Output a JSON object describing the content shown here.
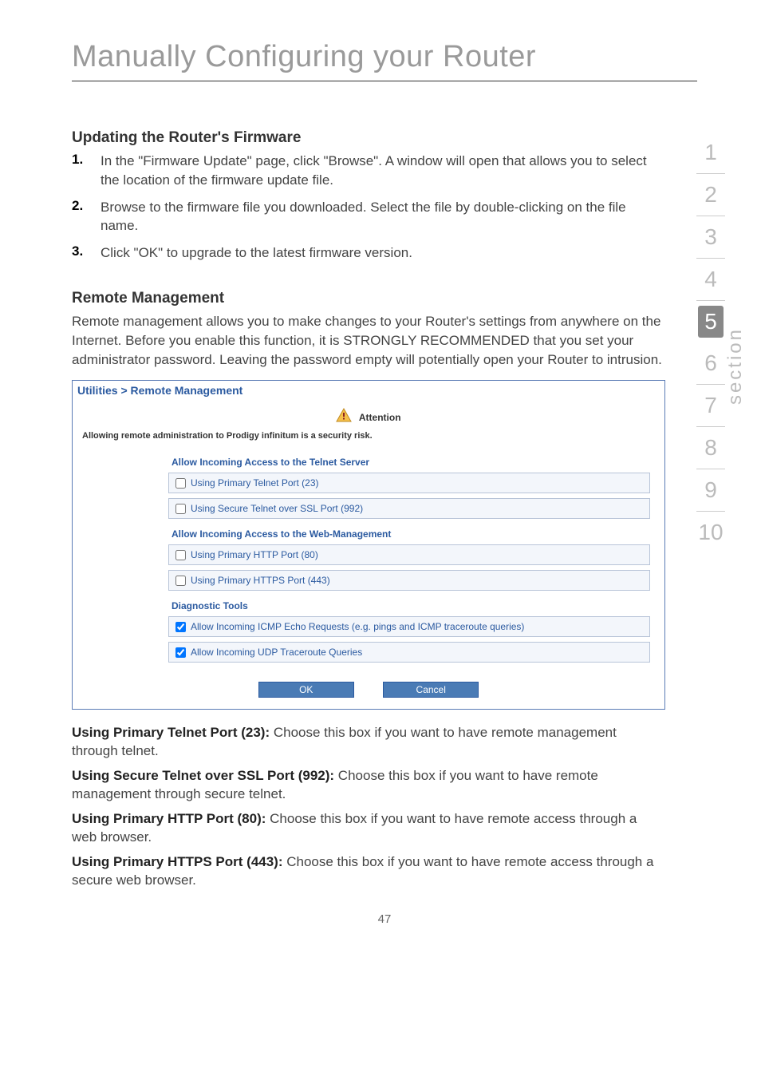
{
  "page_title": "Manually Configuring your Router",
  "nav": {
    "items": [
      "1",
      "2",
      "3",
      "4",
      "5",
      "6",
      "7",
      "8",
      "9",
      "10"
    ],
    "active_index": 4,
    "label": "section"
  },
  "updating": {
    "heading": "Updating the Router's Firmware",
    "steps": [
      {
        "num": "1.",
        "text": "In the \"Firmware Update\" page, click \"Browse\". A window will open that allows you to select the location of the firmware update file."
      },
      {
        "num": "2.",
        "text": "Browse to the firmware file you downloaded. Select the file by double-clicking on the file name."
      },
      {
        "num": "3.",
        "text": "Click \"OK\" to upgrade to the latest firmware version."
      }
    ]
  },
  "remote": {
    "heading": "Remote Management",
    "intro": "Remote management allows you to make changes to your Router's settings from anywhere on the Internet. Before you enable this function, it is STRONGLY RECOMMENDED that you set your administrator password. Leaving the password empty will potentially open your Router to intrusion."
  },
  "panel": {
    "header": "Utilities > Remote Management",
    "attention_label": "Attention",
    "attention_sub": "Allowing remote administration to Prodigy infinitum is a security risk.",
    "sections": [
      {
        "heading": "Allow Incoming Access to the Telnet Server",
        "rows": [
          {
            "label": "Using Primary Telnet Port (23)",
            "checked": false
          },
          {
            "label": "Using Secure Telnet over SSL Port (992)",
            "checked": false
          }
        ]
      },
      {
        "heading": "Allow Incoming Access to the Web-Management",
        "rows": [
          {
            "label": "Using Primary HTTP Port (80)",
            "checked": false
          },
          {
            "label": "Using Primary HTTPS Port (443)",
            "checked": false
          }
        ]
      },
      {
        "heading": "Diagnostic Tools",
        "rows": [
          {
            "label": "Allow Incoming ICMP Echo Requests (e.g. pings and ICMP traceroute queries)",
            "checked": true
          },
          {
            "label": "Allow Incoming UDP Traceroute Queries",
            "checked": true
          }
        ]
      }
    ],
    "ok_label": "OK",
    "cancel_label": "Cancel"
  },
  "definitions": [
    {
      "term": "Using Primary Telnet Port (23):",
      "desc": " Choose this box if you want to have remote management through telnet."
    },
    {
      "term": "Using Secure Telnet over SSL Port (992):",
      "desc": " Choose this box if you want to have remote management through secure telnet."
    },
    {
      "term": "Using Primary HTTP Port (80):",
      "desc": " Choose this box if you want to have remote access through a web browser."
    },
    {
      "term": "Using Primary HTTPS Port (443):",
      "desc": " Choose this box if you want to have remote access through a secure web browser."
    }
  ],
  "page_number": "47"
}
